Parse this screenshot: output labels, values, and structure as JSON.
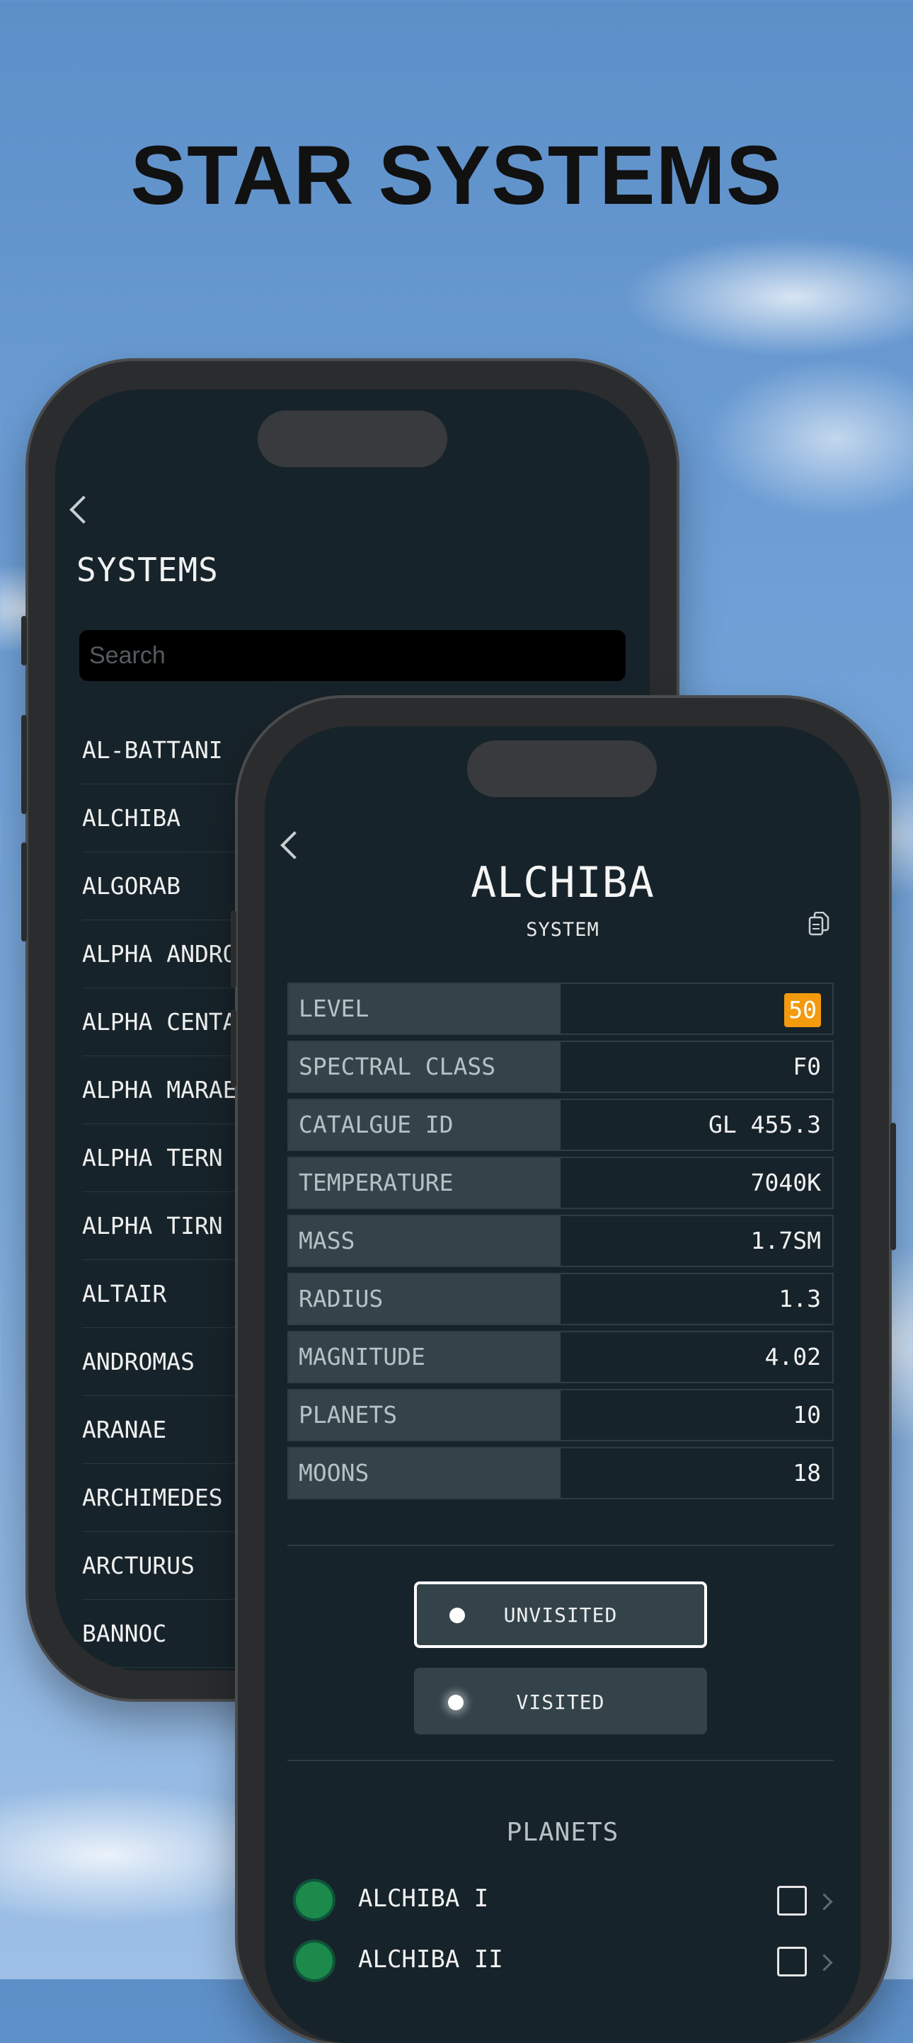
{
  "headline": "STAR SYSTEMS",
  "systems_screen": {
    "title": "SYSTEMS",
    "search_placeholder": "Search",
    "items": [
      "AL-BATTANI",
      "ALCHIBA",
      "ALGORAB",
      "ALPHA ANDROMEDAE",
      "ALPHA CENTAURI",
      "ALPHA MARAE",
      "ALPHA TERN",
      "ALPHA TIRN",
      "ALTAIR",
      "ANDROMAS",
      "ARANAE",
      "ARCHIMEDES",
      "ARCTURUS",
      "BANNOC"
    ]
  },
  "detail_screen": {
    "title": "ALCHIBA",
    "subtitle": "SYSTEM",
    "level_badge_color": "#f39a0e",
    "stats": [
      {
        "label": "LEVEL",
        "value": "50"
      },
      {
        "label": "SPECTRAL CLASS",
        "value": "F0"
      },
      {
        "label": "CATALGUE ID",
        "value": "GL 455.3"
      },
      {
        "label": "TEMPERATURE",
        "value": "7040K"
      },
      {
        "label": "MASS",
        "value": "1.7SM"
      },
      {
        "label": "RADIUS",
        "value": "1.3"
      },
      {
        "label": "MAGNITUDE",
        "value": "4.02"
      },
      {
        "label": "PLANETS",
        "value": "10"
      },
      {
        "label": "MOONS",
        "value": "18"
      }
    ],
    "status_options": {
      "unvisited": "UNVISITED",
      "visited": "VISITED",
      "selected": "UNVISITED"
    },
    "planets_heading": "PLANETS",
    "planets": [
      {
        "name": "ALCHIBA I",
        "color": "#1b8a4a"
      },
      {
        "name": "ALCHIBA II",
        "color": "#1b8a4a"
      }
    ]
  }
}
